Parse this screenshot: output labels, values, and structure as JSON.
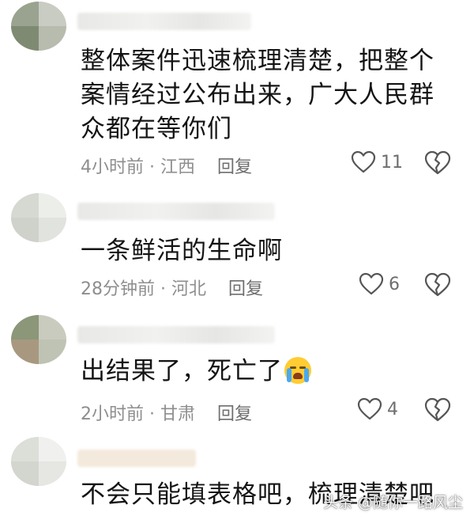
{
  "comments": [
    {
      "text": "整体案件迅速梳理清楚，把整个案情经过公布出来，广大人民群众都在等你们",
      "meta": "4小时前 · 江西",
      "reply_label": "回复",
      "likes": "11"
    },
    {
      "text": "一条鲜活的生命啊",
      "meta": "28分钟前 · 河北",
      "reply_label": "回复",
      "likes": "6"
    },
    {
      "text": "出结果了，死亡了",
      "emoji": "crying-face-icon",
      "meta": "2小时前 · 甘肃",
      "reply_label": "回复",
      "likes": "4"
    },
    {
      "text": "不会只能填表格吧，梳理清楚吧"
    }
  ],
  "watermark": "头条 @随你一路风尘",
  "icons": {
    "like": "heart-outline-icon",
    "dislike": "broken-heart-icon"
  },
  "colors": {
    "text": "#141414",
    "meta": "#8e8e8e",
    "icon": "#555555"
  }
}
